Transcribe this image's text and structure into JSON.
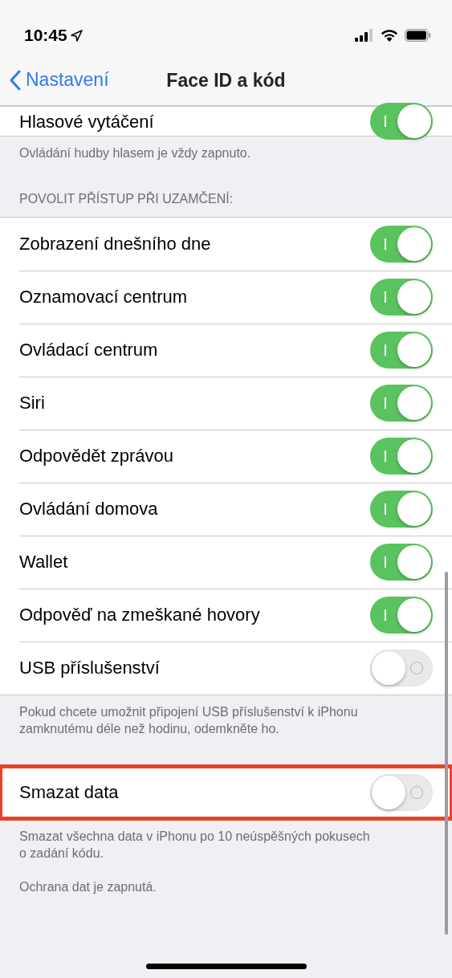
{
  "status_bar": {
    "time": "10:45"
  },
  "nav": {
    "back": "Nastavení",
    "title": "Face ID a kód"
  },
  "sections": [
    {
      "rows": [
        {
          "label": "Hlasové vytáčení",
          "on": true,
          "highlighted": false
        }
      ],
      "footer": [
        "Ovládání hudby hlasem je vždy zapnuto."
      ]
    },
    {
      "header": "POVOLIT PŘÍSTUP PŘI UZAMČENÍ:",
      "rows": [
        {
          "label": "Zobrazení dnešního dne",
          "on": true,
          "highlighted": false
        },
        {
          "label": "Oznamovací centrum",
          "on": true,
          "highlighted": false
        },
        {
          "label": "Ovládací centrum",
          "on": true,
          "highlighted": false
        },
        {
          "label": "Siri",
          "on": true,
          "highlighted": false
        },
        {
          "label": "Odpovědět zprávou",
          "on": true,
          "highlighted": false
        },
        {
          "label": "Ovládání domova",
          "on": true,
          "highlighted": false
        },
        {
          "label": "Wallet",
          "on": true,
          "highlighted": false
        },
        {
          "label": "Odpověď na zmeškané hovory",
          "on": true,
          "highlighted": false
        },
        {
          "label": "USB příslušenství",
          "on": false,
          "highlighted": false
        }
      ],
      "footer": [
        "Pokud chcete umožnit připojení USB příslušenství k iPhonu zamknutému déle než hodinu, odemkněte ho."
      ]
    },
    {
      "rows": [
        {
          "label": "Smazat data",
          "on": false,
          "highlighted": true
        }
      ],
      "footer": [
        "Smazat všechna data v iPhonu po 10 neúspěšných pokusech o zadání kódu.",
        "Ochrana dat je zapnutá."
      ]
    }
  ]
}
